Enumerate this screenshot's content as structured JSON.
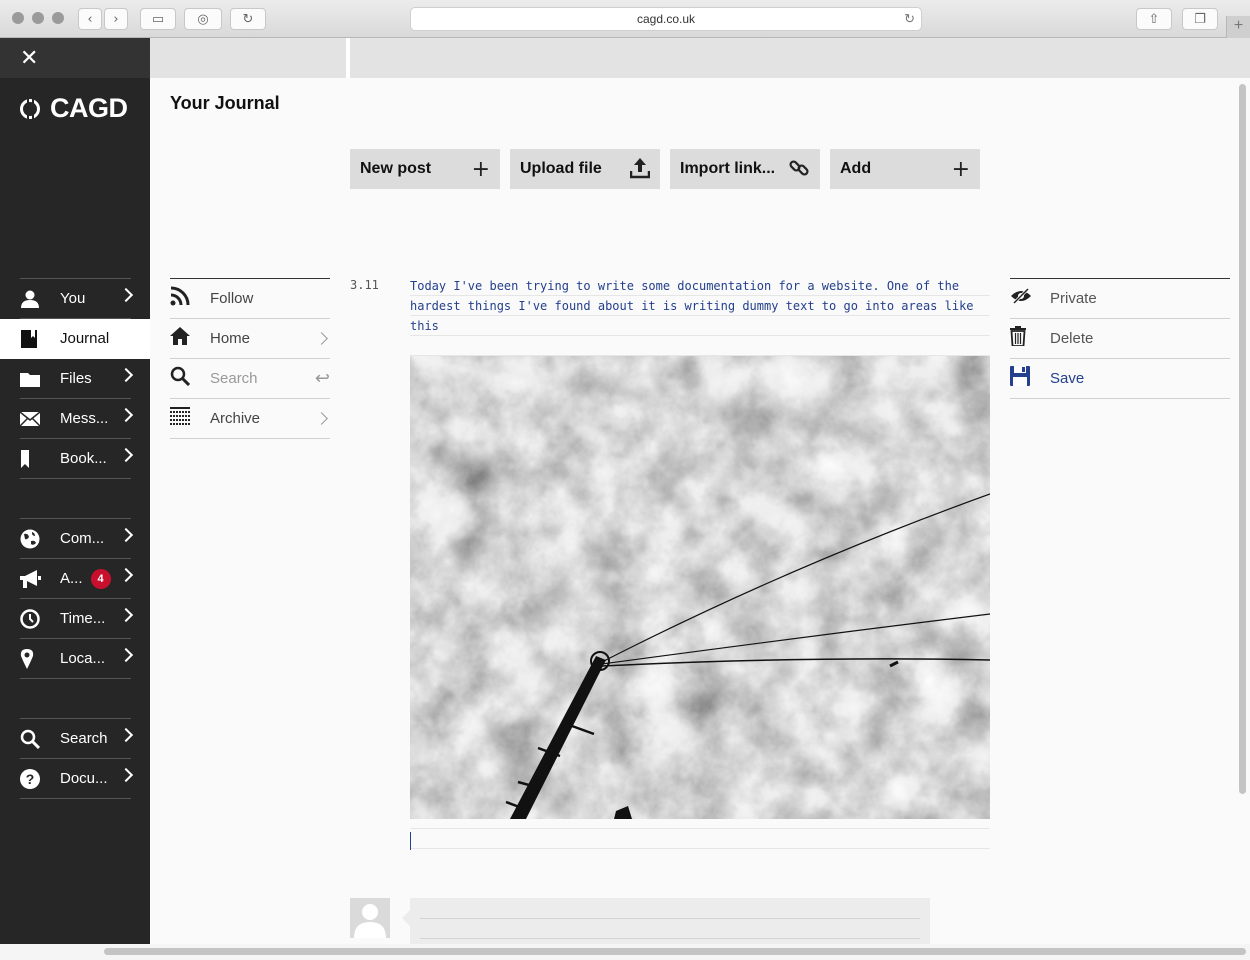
{
  "browser": {
    "url": "cagd.co.uk"
  },
  "brand": {
    "name": "CAGD"
  },
  "sidebar": {
    "groups": [
      [
        {
          "label": "You",
          "icon": "user-icon"
        },
        {
          "label": "Journal",
          "icon": "journal-icon",
          "active": true
        },
        {
          "label": "Files",
          "icon": "folder-icon"
        },
        {
          "label": "Mess...",
          "icon": "envelope-icon"
        },
        {
          "label": "Book...",
          "icon": "bookmark-icon"
        }
      ],
      [
        {
          "label": "Com...",
          "icon": "globe-icon"
        },
        {
          "label": "A...",
          "icon": "megaphone-icon",
          "badge": "4"
        },
        {
          "label": "Time...",
          "icon": "clock-icon"
        },
        {
          "label": "Loca...",
          "icon": "pin-icon"
        }
      ],
      [
        {
          "label": "Search",
          "icon": "search-icon"
        },
        {
          "label": "Docu...",
          "icon": "help-icon"
        }
      ]
    ]
  },
  "page": {
    "title": "Your Journal"
  },
  "actions": [
    {
      "label": "New post",
      "icon": "plus-icon"
    },
    {
      "label": "Upload file",
      "icon": "upload-icon"
    },
    {
      "label": "Import link...",
      "icon": "link-icon"
    },
    {
      "label": "Add",
      "icon": "plus-icon"
    }
  ],
  "subnav": {
    "follow": "Follow",
    "home": "Home",
    "search_placeholder": "Search",
    "archive": "Archive"
  },
  "post": {
    "date": "3.11",
    "text": "Today I've been trying to write some documentation for a website. One of the hardest things I've found about it is writing dummy text to go into areas like this"
  },
  "post_actions": {
    "private": "Private",
    "delete": "Delete",
    "save": "Save"
  },
  "colors": {
    "sidebar_bg": "#262626",
    "accent_blue": "#24408e",
    "badge_red": "#c8102e"
  }
}
